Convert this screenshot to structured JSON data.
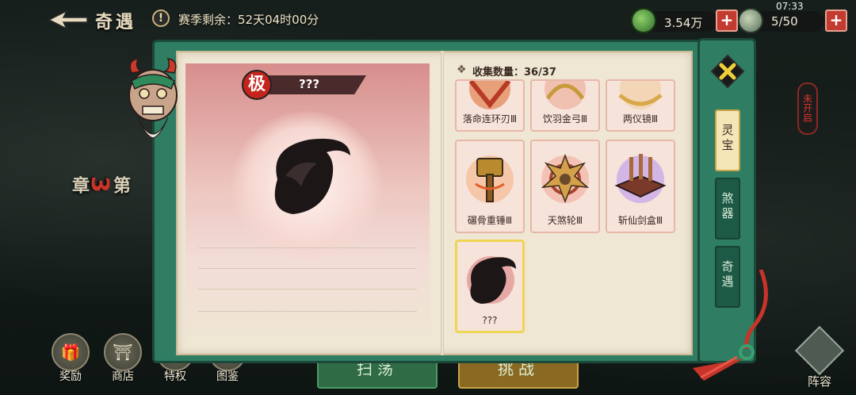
{
  "hud": {
    "title": "奇遇",
    "season_label": "赛季剩余：52天04时00分",
    "resource_1": "3.54万",
    "resource_2": "5/50",
    "clock": "07:33",
    "plus": "+"
  },
  "chapter": {
    "prefix": "第",
    "num": "3",
    "suffix": "章"
  },
  "bottom_nav": [
    {
      "label": "奖励",
      "icon": "gift-icon"
    },
    {
      "label": "商店",
      "icon": "shop-icon"
    },
    {
      "label": "特权",
      "icon": "privilege-icon"
    },
    {
      "label": "图鉴",
      "icon": "codex-icon"
    }
  ],
  "sweep_label": "扫荡",
  "challenge_label": "挑战",
  "lineup_label": "阵容",
  "not_started": "未开启",
  "detail": {
    "rank": "极",
    "name": "???"
  },
  "collection": {
    "label": "收集数量：36/37",
    "items": [
      {
        "name": "落命连环刃Ⅲ",
        "color": "#c2452e"
      },
      {
        "name": "饮羽金弓Ⅲ",
        "color": "#c79a3a"
      },
      {
        "name": "两仪镜Ⅲ",
        "color": "#d8a84a"
      },
      {
        "name": "碾骨重锤Ⅲ",
        "color": "#b98a2e"
      },
      {
        "name": "天煞轮Ⅲ",
        "color": "#a8442e"
      },
      {
        "name": "斩仙剑盒Ⅲ",
        "color": "#7a4a8a"
      },
      {
        "name": "???",
        "color": "#2a1a1a"
      }
    ]
  },
  "tabs": [
    "灵宝",
    "煞器",
    "奇遇"
  ]
}
